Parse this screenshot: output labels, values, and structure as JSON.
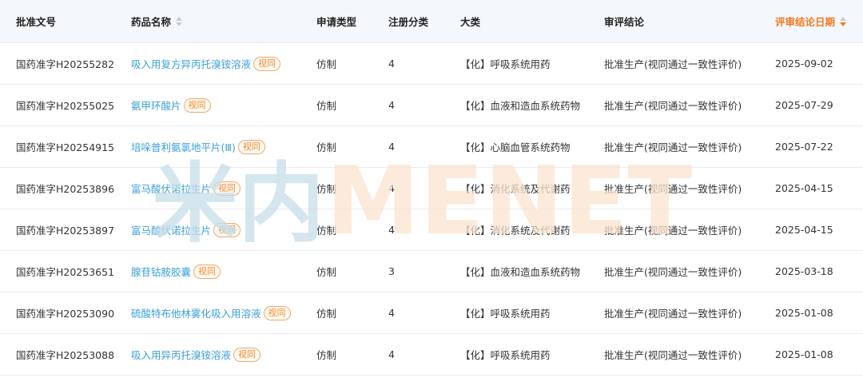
{
  "columns": {
    "approval_no": "批准文号",
    "drug_name": "药品名称",
    "apply_type": "申请类型",
    "reg_class": "注册分类",
    "category": "大类",
    "conclusion": "审评结论",
    "conclusion_date": "评审结论日期"
  },
  "badge_label": "视同",
  "watermark": {
    "left_text": "米内",
    "right_text": "MENET",
    "left_color": "#c5dde8",
    "right_color": "#fbe3cf"
  },
  "colors": {
    "accent": "#f07a1f",
    "link": "#3b9fd9",
    "header_bg": "#f4f7fb"
  },
  "rows": [
    {
      "approval_no": "国药准字H20255282",
      "drug_name": "吸入用复方异丙托溴铵溶液",
      "apply_type": "仿制",
      "reg_class": "4",
      "category": "【化】呼吸系统用药",
      "conclusion": "批准生产(视同通过一致性评价)",
      "date": "2025-09-02"
    },
    {
      "approval_no": "国药准字H20255025",
      "drug_name": "氨甲环酸片",
      "apply_type": "仿制",
      "reg_class": "4",
      "category": "【化】血液和造血系统药物",
      "conclusion": "批准生产(视同通过一致性评价)",
      "date": "2025-07-29"
    },
    {
      "approval_no": "国药准字H20254915",
      "drug_name": "培哚普利氨氯地平片(Ⅲ)",
      "apply_type": "仿制",
      "reg_class": "4",
      "category": "【化】心脑血管系统药物",
      "conclusion": "批准生产(视同通过一致性评价)",
      "date": "2025-07-22"
    },
    {
      "approval_no": "国药准字H20253896",
      "drug_name": "富马酸伏诺拉生片",
      "apply_type": "仿制",
      "reg_class": "4",
      "category": "【化】消化系统及代谢药",
      "conclusion": "批准生产(视同通过一致性评价)",
      "date": "2025-04-15"
    },
    {
      "approval_no": "国药准字H20253897",
      "drug_name": "富马酸伏诺拉生片",
      "apply_type": "仿制",
      "reg_class": "4",
      "category": "【化】消化系统及代谢药",
      "conclusion": "批准生产(视同通过一致性评价)",
      "date": "2025-04-15"
    },
    {
      "approval_no": "国药准字H20253651",
      "drug_name": "腺苷钴胺胶囊",
      "apply_type": "仿制",
      "reg_class": "3",
      "category": "【化】血液和造血系统药物",
      "conclusion": "批准生产(视同通过一致性评价)",
      "date": "2025-03-18"
    },
    {
      "approval_no": "国药准字H20253090",
      "drug_name": "硫酸特布他林雾化吸入用溶液",
      "apply_type": "仿制",
      "reg_class": "4",
      "category": "【化】呼吸系统用药",
      "conclusion": "批准生产(视同通过一致性评价)",
      "date": "2025-01-08"
    },
    {
      "approval_no": "国药准字H20253088",
      "drug_name": "吸入用异丙托溴铵溶液",
      "apply_type": "仿制",
      "reg_class": "4",
      "category": "【化】呼吸系统用药",
      "conclusion": "批准生产(视同通过一致性评价)",
      "date": "2025-01-08"
    }
  ]
}
